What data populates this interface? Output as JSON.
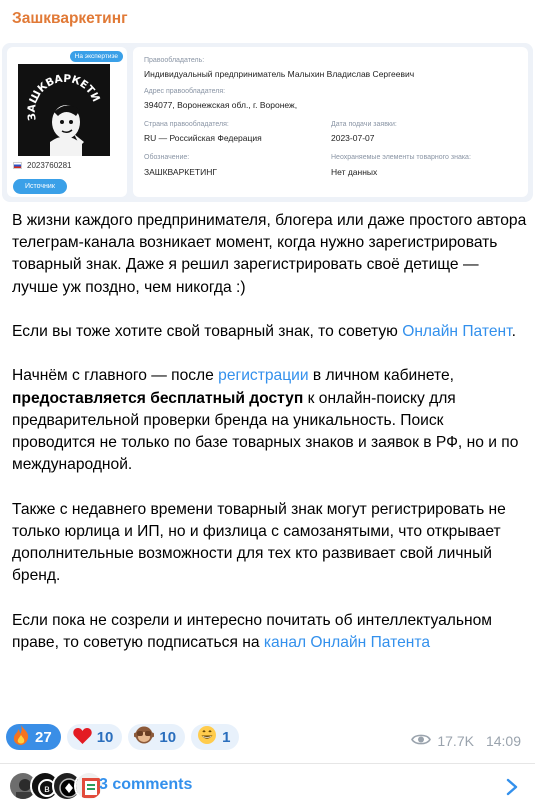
{
  "channel": {
    "name": "Зашкваркетинг"
  },
  "card": {
    "badge": "На экспертизе",
    "reg_number": "2023760281",
    "source_button": "Источник",
    "fields": {
      "owner_label": "Правообладатель:",
      "owner_value": "Индивидуальный предприниматель Малыхин Владислав Сергеевич",
      "address_label": "Адрес правообладателя:",
      "address_value": "394077, Воронежская обл., г. Воронеж,",
      "country_label": "Страна правообладателя:",
      "country_value": "RU — Российская Федерация",
      "date_label": "Дата подачи заявки:",
      "date_value": "2023-07-07",
      "designation_label": "Обозначение:",
      "designation_value": "ЗАШКВАРКЕТИНГ",
      "unprotected_label": "Неохраняемые элементы товарного знака:",
      "unprotected_value": "Нет данных"
    },
    "logo_text": "ЗАШКВАРКЕТИНГ"
  },
  "body": {
    "p1": "В жизни каждого предпринимателя, блогера или даже простого автора телеграм-канала возникает момент, когда нужно зарегистрировать товарный знак. Даже я решил зарегистрировать своё детище — лучше уж поздно, чем никогда :)",
    "p2_before": "Если вы тоже хотите свой товарный знак, то советую ",
    "p2_link": "Онлайн Патент",
    "p2_after": ".",
    "p3_a": "Начнём с главного —  после ",
    "p3_link": "регистрации",
    "p3_b": " в личном кабинете, ",
    "p3_bold": "предоставляется бесплатный доступ",
    "p3_c": " к онлайн-поиску для предварительной проверки бренда на уникальность. Поиск проводится не только по базе товарных знаков и заявок в РФ, но и по международной.",
    "p4": "Также с недавнего времени товарный знак могут регистрировать не только юрлица и ИП, но и физлица с самозанятыми, что открывает дополнительные возможности для тех кто развивает свой личный бренд.",
    "p5_before": "Если пока не созрели и интересно почитать об интеллектуальном праве, то советую подписаться на ",
    "p5_link": "канал Онлайн Патента"
  },
  "reactions": [
    {
      "icon": "fire-emoji",
      "count": "27"
    },
    {
      "icon": "heart-emoji",
      "count": "10"
    },
    {
      "icon": "see-no-evil-monkey-emoji",
      "count": "10"
    },
    {
      "icon": "grinning-emoji",
      "count": "1"
    }
  ],
  "meta": {
    "views": "17.7K",
    "time": "14:09"
  },
  "comments": {
    "label": "3 comments"
  },
  "colors": {
    "accent": "#3390ec",
    "channel": "#e17a37",
    "badge": "#3aa0e8"
  }
}
